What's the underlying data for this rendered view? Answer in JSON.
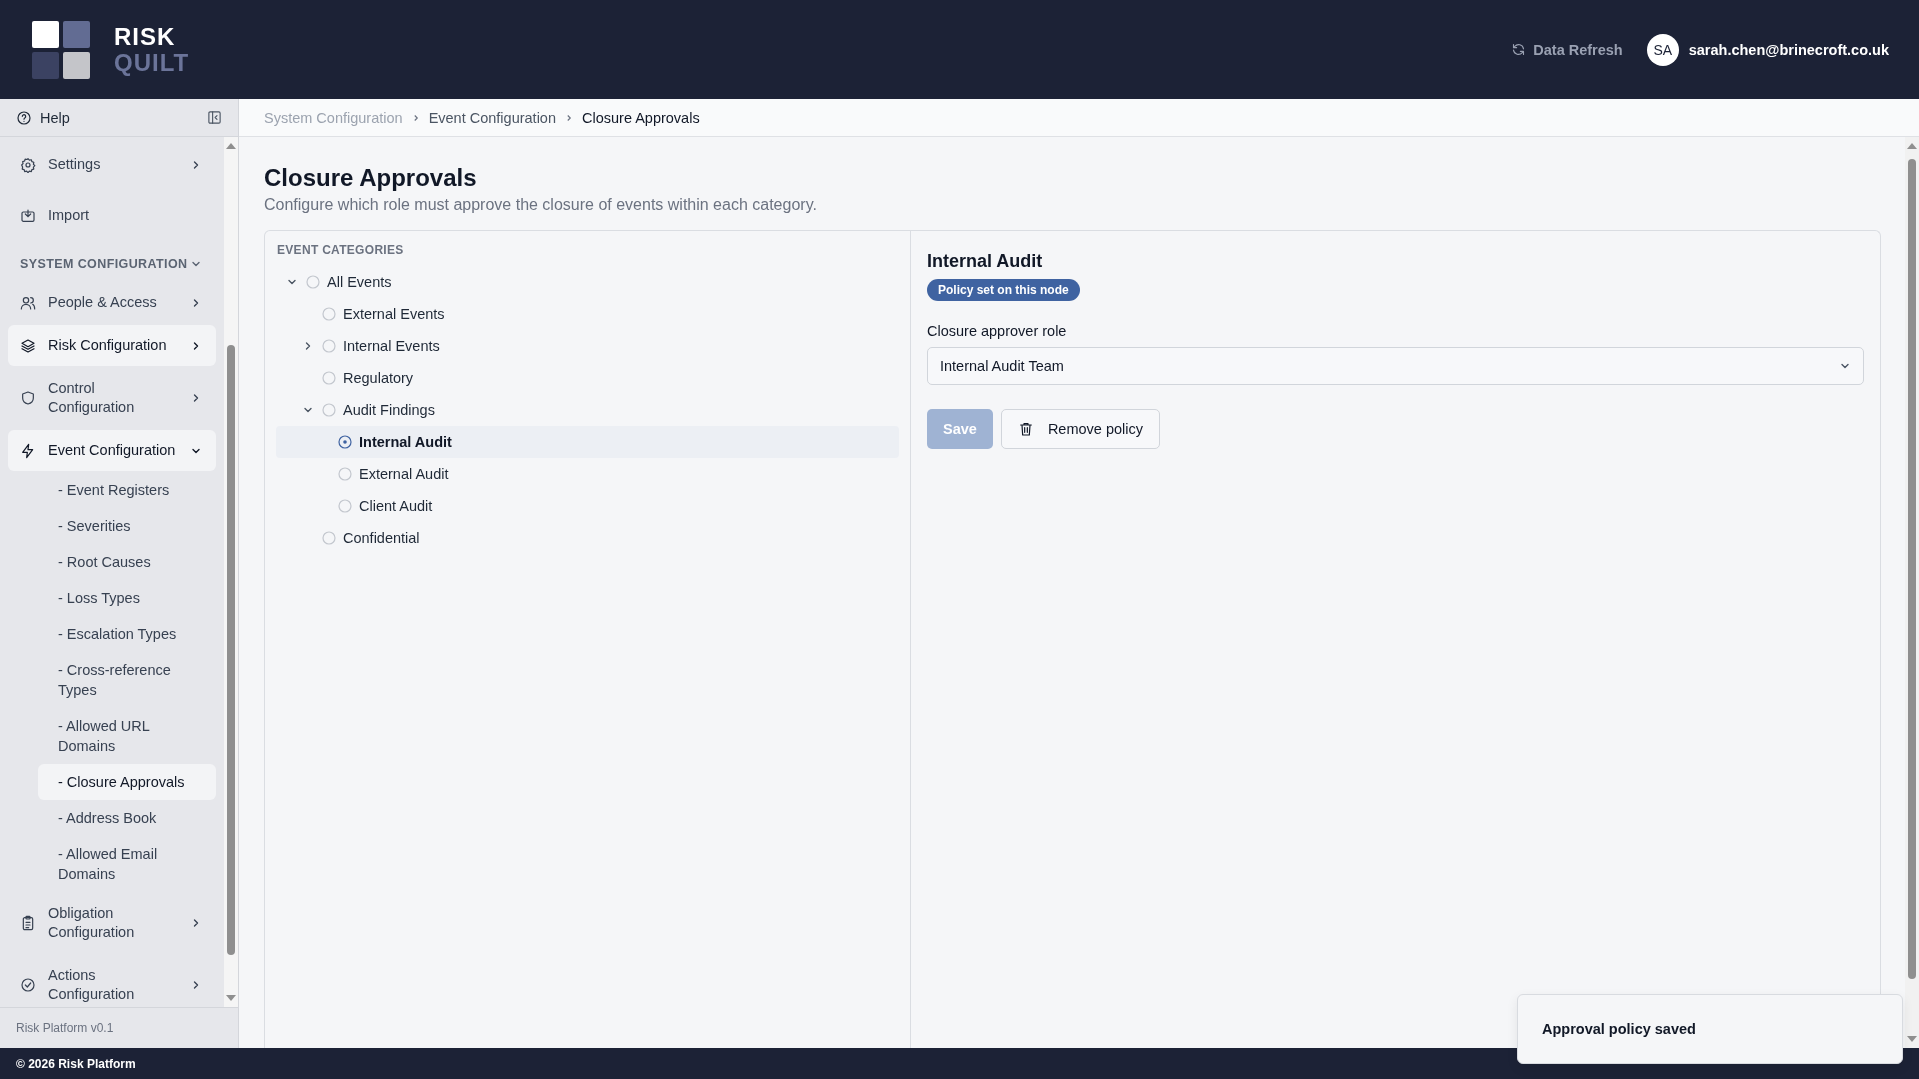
{
  "header": {
    "logo": {
      "line_1": "RISK",
      "line_2": "QUILT"
    },
    "refresh_label": "Data Refresh",
    "user": {
      "initials": "SA",
      "email": "sarah.chen@brinecroft.co.uk"
    }
  },
  "sidebar": {
    "help": "Help",
    "top_items": [
      {
        "kind": "group",
        "label": "Settings",
        "expanded": false,
        "selected": false
      },
      {
        "kind": "link",
        "label": "Import",
        "selected": false
      }
    ],
    "section": {
      "label": "SYSTEM CONFIGURATION",
      "expanded": true
    },
    "groups": [
      {
        "label": "People & Access",
        "expanded": false,
        "selected": false
      },
      {
        "label": "Risk Configuration",
        "expanded": false,
        "selected": true
      },
      {
        "label": "Control Configuration",
        "expanded": false,
        "selected": false
      },
      {
        "label": "Event Configuration",
        "expanded": true,
        "selected": true,
        "children": [
          {
            "label": "- Event Registers",
            "selected": false
          },
          {
            "label": "- Severities",
            "selected": false
          },
          {
            "label": "- Root Causes",
            "selected": false
          },
          {
            "label": "- Loss Types",
            "selected": false
          },
          {
            "label": "- Escalation Types",
            "selected": false
          },
          {
            "label": "- Cross-reference Types",
            "selected": false
          },
          {
            "label": "- Allowed URL Domains",
            "selected": false
          },
          {
            "label": "- Closure Approvals",
            "selected": true
          },
          {
            "label": "- Address Book",
            "selected": false
          },
          {
            "label": "- Allowed Email Domains",
            "selected": false
          }
        ]
      },
      {
        "label": "Obligation Configuration",
        "expanded": false,
        "selected": false
      },
      {
        "label": "Actions Configuration",
        "expanded": false,
        "selected": false
      }
    ],
    "version": "Risk Platform v0.1"
  },
  "breadcrumb": [
    "System Configuration",
    "Event Configuration",
    "Closure Approvals"
  ],
  "page": {
    "title": "Closure Approvals",
    "subtitle": "Configure which role must approve the closure of events within each category."
  },
  "tree": {
    "heading": "EVENT CATEGORIES",
    "nodes": [
      {
        "label": "All Events",
        "expanded": true,
        "selected": false,
        "children": [
          {
            "label": "External Events",
            "selected": false
          },
          {
            "label": "Internal Events",
            "expanded": false,
            "selected": false
          },
          {
            "label": "Regulatory",
            "selected": false
          },
          {
            "label": "Audit Findings",
            "expanded": true,
            "selected": false,
            "children": [
              {
                "label": "Internal Audit",
                "selected": true
              },
              {
                "label": "External Audit",
                "selected": false
              },
              {
                "label": "Client Audit",
                "selected": false
              }
            ]
          },
          {
            "label": "Confidential",
            "selected": false
          }
        ]
      }
    ]
  },
  "detail": {
    "title": "Internal Audit",
    "badge": "Policy set on this node",
    "field_label": "Closure approver role",
    "field_value": "Internal Audit Team",
    "save": {
      "label": "Save",
      "disabled": true
    },
    "remove_label": "Remove policy"
  },
  "toast": "Approval policy saved",
  "footer": "© 2026 Risk Platform"
}
